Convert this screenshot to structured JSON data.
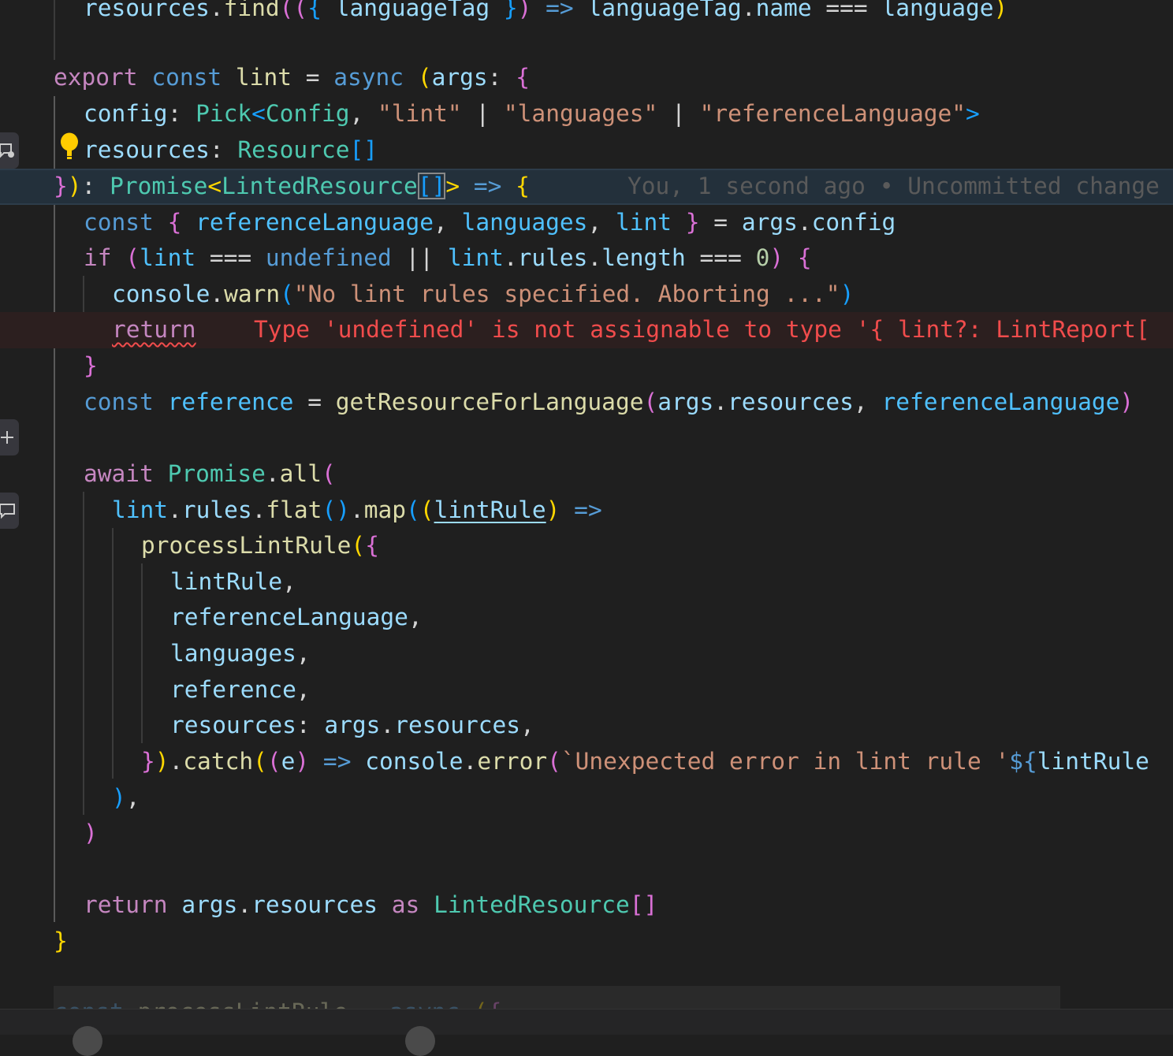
{
  "editor": {
    "language": "typescript",
    "lines": [
      {
        "id": "l0",
        "tokens": [
          "resources",
          ".",
          "find",
          "((",
          "{ ",
          "languageTag",
          " }",
          ")",
          " => ",
          "languageTag",
          ".",
          "name",
          " === ",
          "language",
          ")"
        ]
      },
      {
        "id": "l2",
        "tokens": [
          "export",
          " ",
          "const",
          " ",
          "lint",
          " = ",
          "async",
          " ",
          "(",
          "args",
          ": ",
          "{"
        ]
      },
      {
        "id": "l3",
        "tokens": [
          "config",
          ": ",
          "Pick",
          "<",
          "Config",
          ", ",
          "\"lint\"",
          " | ",
          "\"languages\"",
          " | ",
          "\"referenceLanguage\"",
          ">"
        ]
      },
      {
        "id": "l4",
        "tokens": [
          "resources",
          ": ",
          "Resource",
          "[]"
        ]
      },
      {
        "id": "l5",
        "tokens": [
          "}",
          ")",
          ": ",
          "Promise",
          "<",
          "LintedResource",
          "[",
          "]",
          ">",
          " => ",
          "{"
        ]
      },
      {
        "id": "l6",
        "tokens": [
          "const",
          " ",
          "{",
          " ",
          "referenceLanguage",
          ", ",
          "languages",
          ", ",
          "lint",
          " ",
          "}",
          " = ",
          "args",
          ".",
          "config"
        ]
      },
      {
        "id": "l7",
        "tokens": [
          "if",
          " ",
          "(",
          "lint",
          " === ",
          "undefined",
          " || ",
          "lint",
          ".",
          "rules",
          ".",
          "length",
          " === ",
          "0",
          ")",
          " ",
          "{"
        ]
      },
      {
        "id": "l8",
        "tokens": [
          "console",
          ".",
          "warn",
          "(",
          "\"No lint rules specified. Aborting ...\"",
          ")"
        ]
      },
      {
        "id": "l9",
        "tokens": [
          "return"
        ]
      },
      {
        "id": "l10",
        "tokens": [
          "}"
        ]
      },
      {
        "id": "l11",
        "tokens": [
          "const",
          " ",
          "reference",
          " = ",
          "getResourceForLanguage",
          "(",
          "args",
          ".",
          "resources",
          ", ",
          "referenceLanguage",
          ")"
        ]
      },
      {
        "id": "l13",
        "tokens": [
          "await",
          " ",
          "Promise",
          ".",
          "all",
          "("
        ]
      },
      {
        "id": "l14",
        "tokens": [
          "lint",
          ".",
          "rules",
          ".",
          "flat",
          "()",
          ".",
          "map",
          "(",
          "(",
          "lintRule",
          ")",
          " => "
        ]
      },
      {
        "id": "l15",
        "tokens": [
          "processLintRule",
          "(",
          "{"
        ]
      },
      {
        "id": "l16",
        "tokens": [
          "lintRule",
          ","
        ]
      },
      {
        "id": "l17",
        "tokens": [
          "referenceLanguage",
          ","
        ]
      },
      {
        "id": "l18",
        "tokens": [
          "languages",
          ","
        ]
      },
      {
        "id": "l19",
        "tokens": [
          "reference",
          ","
        ]
      },
      {
        "id": "l20",
        "tokens": [
          "resources",
          ": ",
          "args",
          ".",
          "resources",
          ","
        ]
      },
      {
        "id": "l21",
        "tokens": [
          "}",
          ")",
          ".",
          "catch",
          "(",
          "(",
          "e",
          ")",
          " => ",
          "console",
          ".",
          "error",
          "(",
          "`Unexpected error in lint rule '",
          "${",
          "lintRule"
        ]
      },
      {
        "id": "l22",
        "tokens": [
          ")",
          ","
        ]
      },
      {
        "id": "l23",
        "tokens": [
          ")"
        ]
      },
      {
        "id": "l25",
        "tokens": [
          "return",
          " ",
          "args",
          ".",
          "resources",
          " ",
          "as",
          " ",
          "LintedResource",
          "[]"
        ]
      },
      {
        "id": "l26",
        "tokens": [
          "}"
        ]
      },
      {
        "id": "l28",
        "tokens": [
          "const",
          " ",
          "processLintRule",
          " = ",
          "async",
          " ",
          "(",
          "{"
        ]
      }
    ],
    "blame": "You, 1 second ago • Uncommitted change",
    "diagnostic": "Type 'undefined' is not assignable to type '{ lint?: LintReport["
  },
  "colors": {
    "background": "#1f1f1f",
    "keyword_control": "#c586c0",
    "keyword_declaration": "#569cd6",
    "variable": "#9cdcfe",
    "constant": "#4fc1ff",
    "function": "#dcdcaa",
    "type": "#4ec9b0",
    "string": "#ce9178",
    "number": "#b5cea8",
    "bracket_1": "#ffd700",
    "bracket_2": "#da70d6",
    "bracket_3": "#179fff",
    "error": "#f14c4c",
    "blame": "#5a5a5a",
    "current_line": "#23303b"
  },
  "gutter": {
    "buttons": [
      {
        "icon": "comment-plus-icon"
      },
      {
        "icon": "add-icon"
      },
      {
        "icon": "comment-icon"
      }
    ],
    "lightbulb_icon": "lightbulb-icon"
  }
}
